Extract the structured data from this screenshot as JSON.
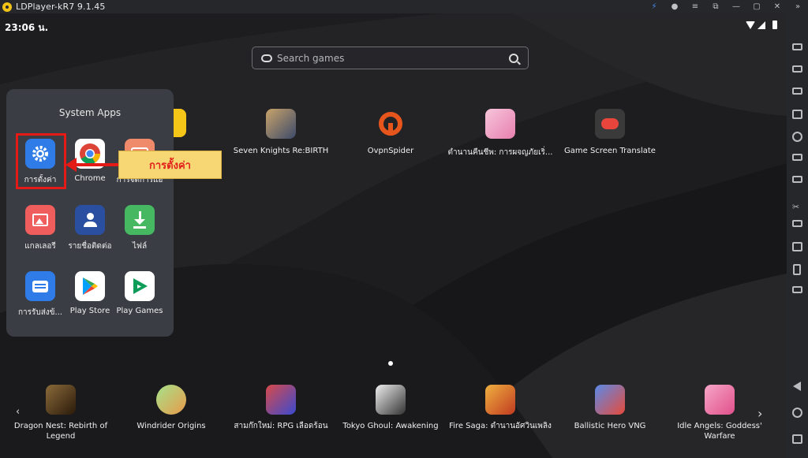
{
  "titlebar": {
    "title": "LDPlayer-kR7 9.1.45"
  },
  "status": {
    "time": "23:06 น."
  },
  "search": {
    "placeholder": "Search games"
  },
  "folder": {
    "title": "System Apps",
    "apps": [
      {
        "label": "การตั้งค่า",
        "icon": "settings-gear-icon",
        "color": "#2f7be8"
      },
      {
        "label": "Chrome",
        "icon": "chrome-icon",
        "color": "#ffffff"
      },
      {
        "label": "การจัดการแอ",
        "icon": "app-manager-icon",
        "color": "#ef8a6a"
      },
      {
        "label": "แกลเลอรี",
        "icon": "gallery-icon",
        "color": "#ef5d5d"
      },
      {
        "label": "รายชื่อติดต่อ",
        "icon": "contacts-icon",
        "color": "#3f6fd8"
      },
      {
        "label": "ไฟล์",
        "icon": "download-file-icon",
        "color": "#47b862"
      },
      {
        "label": "การรับส่งข้...",
        "icon": "messages-icon",
        "color": "#2f7be8"
      },
      {
        "label": "Play Store",
        "icon": "play-store-icon",
        "color": "#ffffff"
      },
      {
        "label": "Play Games",
        "icon": "play-games-icon",
        "color": "#ffffff"
      }
    ]
  },
  "callout": {
    "text": "การตั้งค่า"
  },
  "desktop_apps": [
    {
      "label": "Seven Knights Re:BIRTH",
      "icon": "seven-knights-icon",
      "color": "#8a6a4a"
    },
    {
      "label": "OvpnSpider",
      "icon": "ovpnspider-icon",
      "color": "#e6561c"
    },
    {
      "label": "ตำนานคืนชีพ: การผจญภัยเริ่...",
      "icon": "anime-game-icon",
      "color": "#f2a6c8"
    },
    {
      "label": "Game Screen Translate",
      "icon": "gamepad-translate-icon",
      "color": "#3a3a3a"
    }
  ],
  "dock_apps": [
    {
      "label": "Dragon Nest: Rebirth of Legend",
      "icon": "dragon-nest-icon",
      "color": "#6b4a2a"
    },
    {
      "label": "Windrider Origins",
      "icon": "windrider-icon",
      "color": "#6bbf6b"
    },
    {
      "label": "สามก๊กใหม่: RPG เลือดร้อน",
      "icon": "three-kingdoms-icon",
      "color": "#b83a3a"
    },
    {
      "label": "Tokyo Ghoul: Awakening",
      "icon": "tokyo-ghoul-icon",
      "color": "#d9d9d9"
    },
    {
      "label": "Fire Saga: ตำนานอัศวินเพลิง",
      "icon": "fire-saga-icon",
      "color": "#d8842a"
    },
    {
      "label": "Ballistic Hero VNG",
      "icon": "ballistic-hero-icon",
      "color": "#3c6ad0"
    },
    {
      "label": "Idle Angels: Goddess' Warfare",
      "icon": "idle-angels-icon",
      "color": "#f08ab0"
    }
  ]
}
